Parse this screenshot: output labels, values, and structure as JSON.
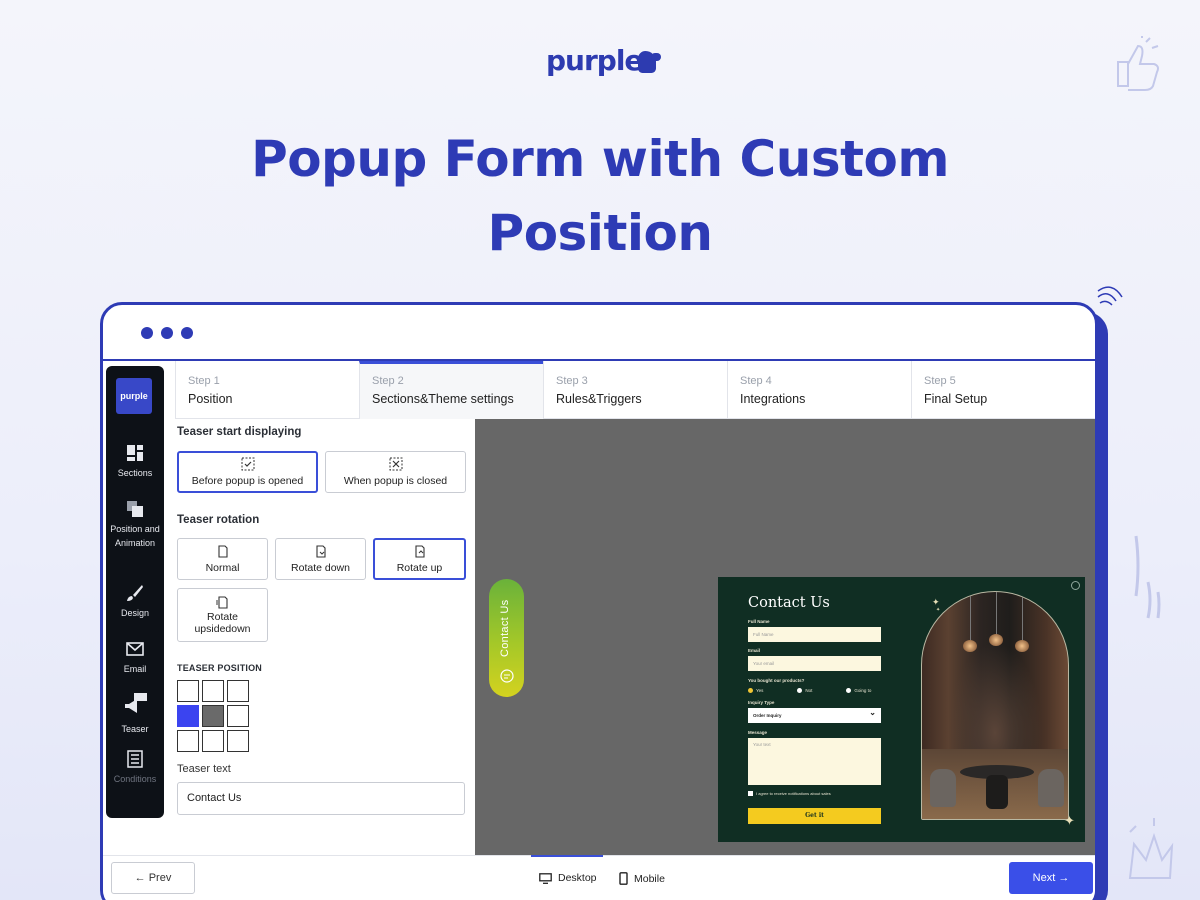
{
  "brand": {
    "logo_text": "purple",
    "side_logo_text": "purple"
  },
  "hero": {
    "title_line1": "Popup Form with Custom",
    "title_line2": "Position"
  },
  "colors": {
    "accent": "#2e3bb5",
    "primary_button": "#3a4fe8",
    "selected_cell": "#3b44f0",
    "popup_bg": "#102e23",
    "popup_button": "#f4cb1f"
  },
  "sidebar": {
    "items": [
      {
        "label": "Sections",
        "icon": "sections-icon"
      },
      {
        "label": "Position and Animation",
        "icon": "layers-icon"
      },
      {
        "label": "Design",
        "icon": "brush-icon"
      },
      {
        "label": "Email",
        "icon": "envelope-icon"
      },
      {
        "label": "Teaser",
        "icon": "megaphone-icon",
        "badge": "Teaser"
      },
      {
        "label": "Conditions",
        "icon": "list-icon"
      }
    ]
  },
  "steps": [
    {
      "num": "Step 1",
      "name": "Position"
    },
    {
      "num": "Step 2",
      "name": "Sections&Theme settings",
      "active": true
    },
    {
      "num": "Step 3",
      "name": "Rules&Triggers"
    },
    {
      "num": "Step 4",
      "name": "Integrations"
    },
    {
      "num": "Step 5",
      "name": "Final Setup"
    }
  ],
  "panel": {
    "start_label": "Teaser start displaying",
    "start_options": [
      "Before popup is opened",
      "When popup is closed"
    ],
    "rotation_label": "Teaser rotation",
    "rotation_options": [
      "Normal",
      "Rotate down",
      "Rotate up",
      "Rotate upsidedown"
    ],
    "position_label": "TEASER POSITION",
    "text_label": "Teaser text",
    "text_value": "Contact Us"
  },
  "preview": {
    "teaser_text": "Contact Us",
    "popup": {
      "title": "Contact Us",
      "full_name_label": "Full Name",
      "full_name_placeholder": "Full Name",
      "email_label": "Email",
      "email_placeholder": "Your email",
      "question": "You bought our products?",
      "radio_options": [
        "Yes",
        "Not",
        "Going to"
      ],
      "inquiry_label": "Inquiry Type",
      "inquiry_value": "Order Inquiry",
      "message_label": "Message",
      "message_placeholder": "Your text",
      "consent": "I agree to receive notifications about sales",
      "button": "Get it"
    }
  },
  "bottom": {
    "prev": "← Prev",
    "desktop": "Desktop",
    "mobile": "Mobile",
    "next": "Next →"
  }
}
